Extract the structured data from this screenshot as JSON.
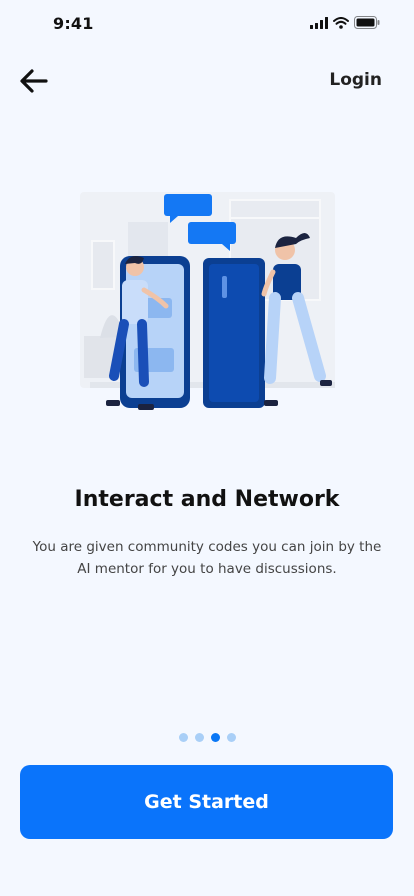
{
  "status_bar": {
    "time": "9:41"
  },
  "nav": {
    "login_label": "Login"
  },
  "onboarding": {
    "title": "Interact and Network",
    "description": "You are given community codes you can join by the AI mentor for you to have discussions.",
    "dots": [
      {
        "active": false
      },
      {
        "active": false
      },
      {
        "active": true
      },
      {
        "active": false
      }
    ]
  },
  "cta": {
    "label": "Get Started"
  },
  "colors": {
    "background": "#F4F8FF",
    "primary": "#0A74FB",
    "dot_inactive": "#A9CFF7",
    "dot_active": "#0A77F5",
    "illustration_dark": "#0B3F92"
  }
}
